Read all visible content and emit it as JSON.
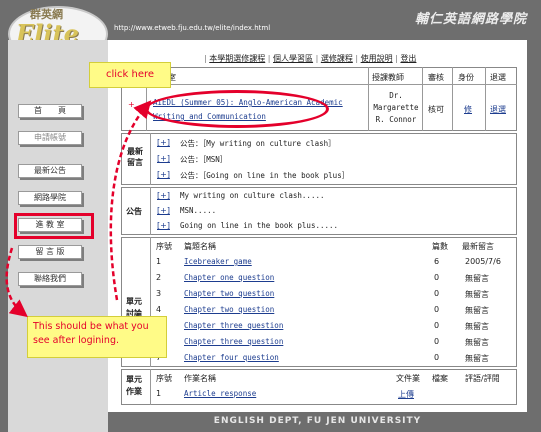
{
  "header": {
    "logo_cn": "群英網",
    "logo_en": "Elite",
    "url": "http://www.etweb.fju.edu.tw/elite/index.html",
    "site_title": "輔仁英語網路學院"
  },
  "sidebar": {
    "items": [
      {
        "label": "首　　頁",
        "dim": false
      },
      {
        "label": "申請帳號",
        "dim": true
      },
      {
        "label": "最新公告",
        "dim": false
      },
      {
        "label": "網路學院",
        "dim": false
      },
      {
        "label": "進 教 室",
        "dim": false
      },
      {
        "label": "留 言 版",
        "dim": false
      },
      {
        "label": "聯絡我們",
        "dim": false
      }
    ]
  },
  "topnav": {
    "items": [
      "本學期選修課程",
      "個人學習區",
      "選修課程",
      "使用說明",
      "登出"
    ]
  },
  "course_table": {
    "headers": {
      "classroom": "教室",
      "teacher": "授課教師",
      "review": "審核",
      "identity": "身份",
      "drop": "退選"
    },
    "course_name": "AIEDL (Summer 05): Anglo-American Academic Writing and Communication",
    "teacher": "Dr. Margarette R. Connor",
    "review": "核可",
    "identity": "修",
    "drop": "退選",
    "plus": "+"
  },
  "latest_messages": {
    "label_line1": "最新",
    "label_line2": "留言",
    "items": [
      {
        "plus": "[+]",
        "text": "公告：［My writing on culture clash］"
      },
      {
        "plus": "[+]",
        "text": "公告：［MSN］"
      },
      {
        "plus": "[+]",
        "text": "公告：［Going on line in the book plus］"
      }
    ]
  },
  "announcements": {
    "label": "公告",
    "items": [
      {
        "plus": "[+]",
        "text": "My writing on culture clash....."
      },
      {
        "plus": "[+]",
        "text": "MSN....."
      },
      {
        "plus": "[+]",
        "text": "Going on line in the book plus....."
      }
    ]
  },
  "unit_discussion": {
    "label_line1": "單元",
    "label_line2": "討論",
    "headers": {
      "no": "序號",
      "title": "篇題名稱",
      "posts": "篇數",
      "latest": "最新留言"
    },
    "rows": [
      {
        "no": "1",
        "title": "Icebreaker game",
        "posts": "6",
        "latest": "2005/7/6"
      },
      {
        "no": "2",
        "title": "Chapter one question",
        "posts": "0",
        "latest": "無留言"
      },
      {
        "no": "3",
        "title": "Chapter two question",
        "posts": "0",
        "latest": "無留言"
      },
      {
        "no": "4",
        "title": "Chapter two question",
        "posts": "0",
        "latest": "無留言"
      },
      {
        "no": "5",
        "title": "Chapter three question",
        "posts": "0",
        "latest": "無留言"
      },
      {
        "no": "6",
        "title": "Chapter three question",
        "posts": "0",
        "latest": "無留言"
      },
      {
        "no": "7",
        "title": "Chapter four question",
        "posts": "0",
        "latest": "無留言"
      }
    ]
  },
  "unit_homework": {
    "label_line1": "單元",
    "label_line2": "作業",
    "headers": {
      "no": "序號",
      "name": "作業名稱",
      "file": "文件業",
      "archive": "檔案",
      "grade": "評語/評閱"
    },
    "rows": [
      {
        "no": "1",
        "name": "Article response",
        "file": "上傳"
      }
    ]
  },
  "annotations": {
    "click_here": "click here",
    "after_login": "This should be what you see after logining."
  },
  "footer": {
    "text": "ENGLISH DEPT, FU JEN UNIVERSITY"
  },
  "colors": {
    "header_gray": "#6e6e6e",
    "sidebar_gray": "#d9d9d9",
    "annotation_red": "#e4002b",
    "callout_yellow": "#fffb87",
    "link_blue": "#1d3d8f"
  }
}
